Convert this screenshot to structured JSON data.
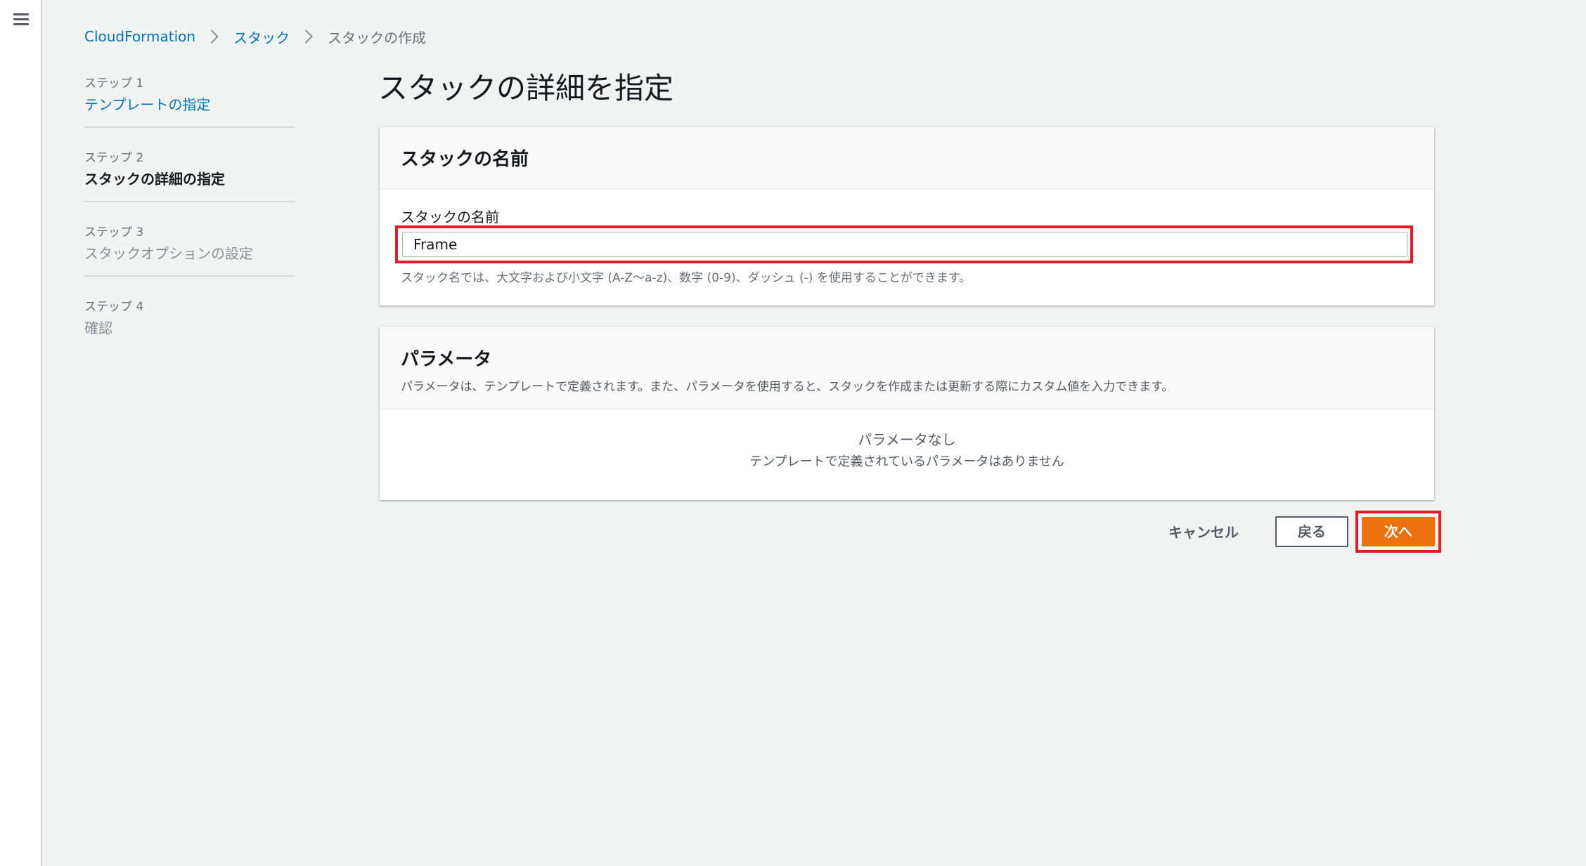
{
  "nav": {
    "menu_icon": "hamburger-icon"
  },
  "breadcrumb": {
    "items": [
      "CloudFormation",
      "スタック",
      "スタックの作成"
    ]
  },
  "steps": [
    {
      "number": "ステップ 1",
      "title": "テンプレートの指定",
      "state": "link"
    },
    {
      "number": "ステップ 2",
      "title": "スタックの詳細の指定",
      "state": "current"
    },
    {
      "number": "ステップ 3",
      "title": "スタックオプションの設定",
      "state": "disabled"
    },
    {
      "number": "ステップ 4",
      "title": "確認",
      "state": "disabled"
    }
  ],
  "page_title": "スタックの詳細を指定",
  "stack_name_panel": {
    "title": "スタックの名前",
    "field_label": "スタックの名前",
    "field_value": "Frame",
    "hint": "スタック名では、大文字および小文字 (A-Z〜a-z)、数字 (0-9)、ダッシュ (-) を使用することができます。"
  },
  "parameters_panel": {
    "title": "パラメータ",
    "description": "パラメータは、テンプレートで定義されます。また、パラメータを使用すると、スタックを作成または更新する際にカスタム値を入力できます。",
    "empty_title": "パラメータなし",
    "empty_subtitle": "テンプレートで定義されているパラメータはありません"
  },
  "actions": {
    "cancel": "キャンセル",
    "back": "戻る",
    "next": "次へ"
  },
  "colors": {
    "link": "#0073bb",
    "primary_button": "#ec7211",
    "highlight_box": "#e51c23",
    "background": "#f2f3f3"
  }
}
